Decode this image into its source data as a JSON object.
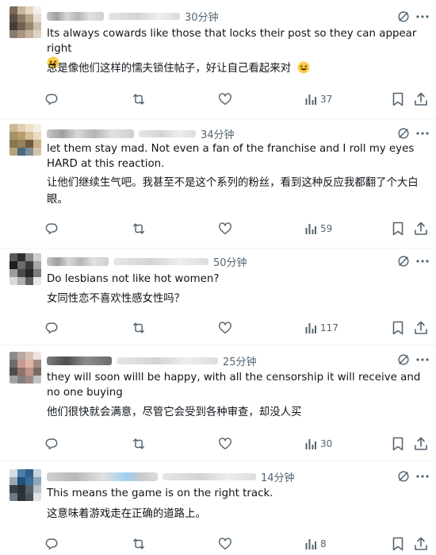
{
  "posts": [
    {
      "time": "30分钟",
      "text": "Its always cowards like those that locks their post so they can appear right",
      "text_emoji": "grinning-squinting-face",
      "translation": "总是像他们这样的懦夫锁住帖子，好让自己看起来对",
      "translation_emoji": "grinning-squinting-face",
      "views": "37"
    },
    {
      "time": "34分钟",
      "text": "let them stay mad. Not even a fan of the franchise and I roll my eyes HARD at this reaction.",
      "translation": "让他们继续生气吧。我甚至不是这个系列的粉丝，看到这种反应我都翻了个大白眼。",
      "views": "59"
    },
    {
      "time": "50分钟",
      "text": "Do lesbians not like hot women?",
      "translation": "女同性恋不喜欢性感女性吗？",
      "views": "117"
    },
    {
      "time": "25分钟",
      "text": "they will soon willl be happy, with all the censorship it will receive and no one buying",
      "translation": "他们很快就会满意，尽管它会受到各种审查，却没人买",
      "views": "30"
    },
    {
      "time": "14分钟",
      "text": "This means the game is on the right track.",
      "translation": "这意味着游戏走在正确的道路上。",
      "views": "8"
    }
  ],
  "icons": {
    "reply": "reply-icon",
    "repost": "repost-icon",
    "like": "like-icon",
    "views": "views-icon",
    "bookmark": "bookmark-icon",
    "share": "share-icon",
    "grok": "grok-icon",
    "more": "more-icon"
  },
  "colors": {
    "icon": "#536471",
    "text": "#0f1419",
    "divider": "#eff3f4",
    "emoji": "#ffcc4d"
  }
}
